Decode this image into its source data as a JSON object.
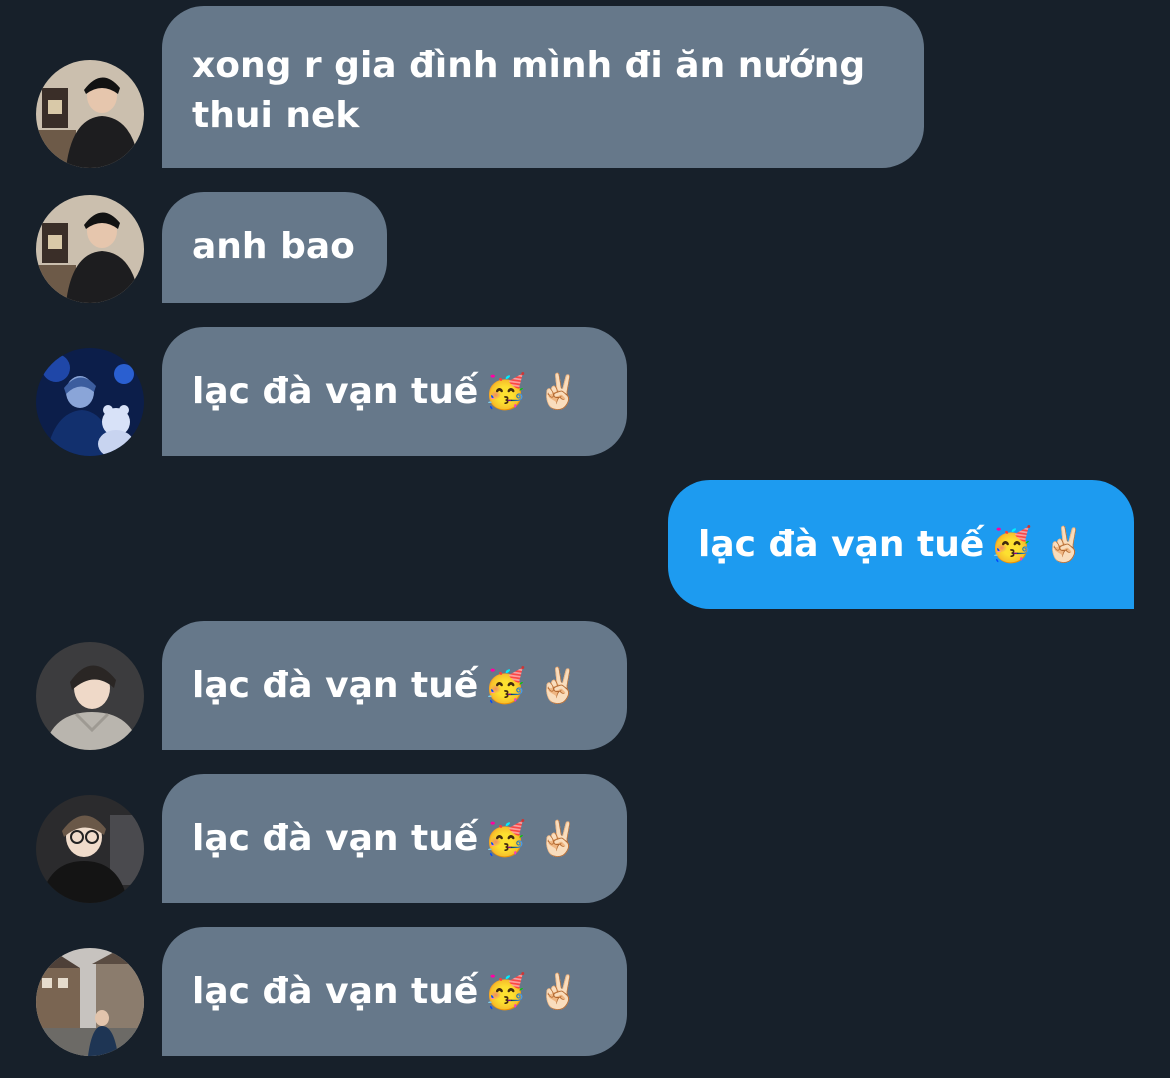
{
  "conversation": {
    "messages": [
      {
        "direction": "in",
        "avatar": "avatar-photo-boy-dark-hoodie",
        "text": "xong r gia đình mình đi ăn nướng thui nek"
      },
      {
        "direction": "in",
        "avatar": "avatar-photo-boy-dark-hoodie",
        "text": "anh bao"
      },
      {
        "direction": "in",
        "avatar": "avatar-photo-blue-night-teddy",
        "text": "lạc đà vạn tuế",
        "emoji": "🥳 ✌🏻"
      },
      {
        "direction": "out",
        "text": "lạc đà vạn tuế",
        "emoji": "🥳 ✌🏻"
      },
      {
        "direction": "in",
        "avatar": "avatar-photo-boy-grey-hoodie",
        "text": "lạc đà vạn tuế",
        "emoji": "🥳 ✌🏻"
      },
      {
        "direction": "in",
        "avatar": "avatar-photo-boy-glasses",
        "text": "lạc đà vạn tuế",
        "emoji": "🥳 ✌🏻"
      },
      {
        "direction": "in",
        "avatar": "avatar-photo-street-houses",
        "text": "lạc đà vạn tuế",
        "emoji": "🥳 ✌🏻"
      }
    ]
  },
  "colors": {
    "background": "#17202a",
    "incoming_bubble": "#66788a",
    "outgoing_bubble": "#1d9bf0",
    "text": "#ffffff"
  }
}
